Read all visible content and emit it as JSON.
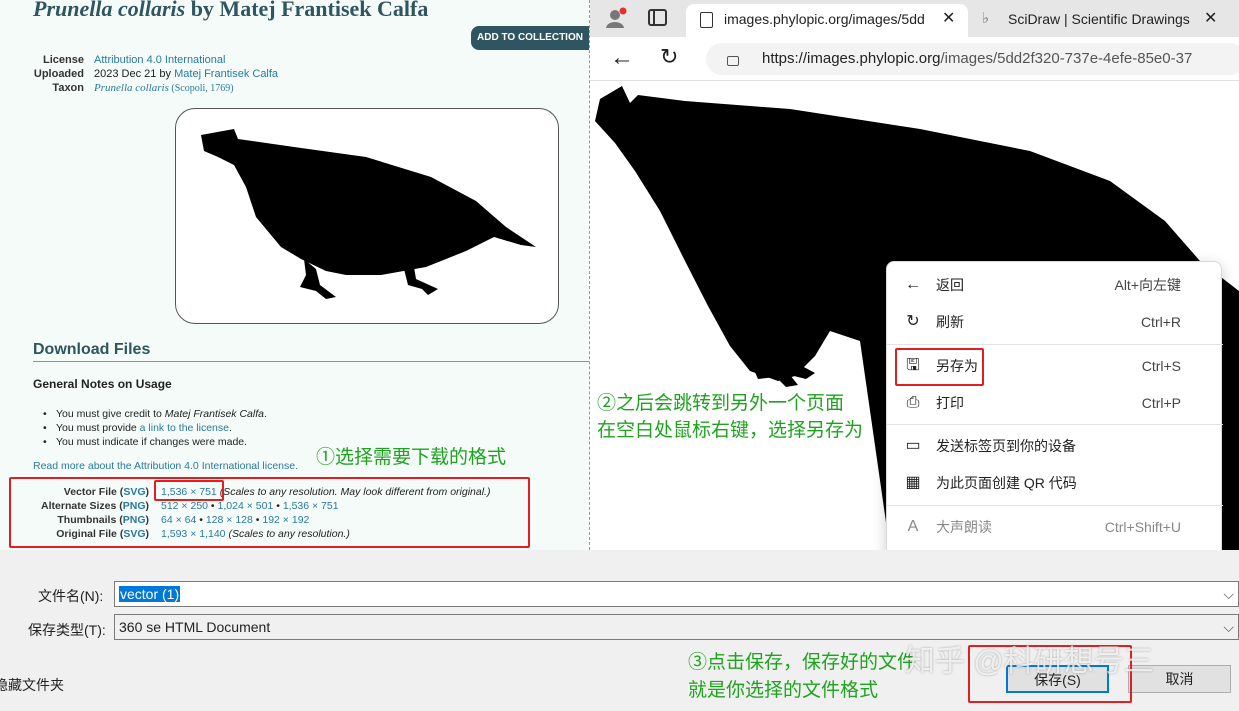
{
  "left_page": {
    "title_taxon": "Prunella collaris",
    "title_rest": " by Matej Frantisek Calfa",
    "add_button": "ADD TO COLLECTION",
    "meta": [
      {
        "key": "License",
        "value": "Attribution 4.0 International"
      },
      {
        "key": "Uploaded",
        "value": "2023 Dec 21 by ",
        "link": "Matej Frantisek Calfa"
      },
      {
        "key": "Taxon",
        "value": "Prunella collaris",
        "extra": " (Scopoli, 1769)"
      }
    ],
    "download_heading": "Download Files",
    "notes_heading": "General Notes on Usage",
    "notes": [
      {
        "pre": "You must give credit to ",
        "em": "Matej Frantisek Calfa",
        "post": ".",
        "link": ""
      },
      {
        "pre": "You must provide ",
        "em": "",
        "post": ".",
        "link": "a link to the license"
      },
      {
        "pre": "You must indicate if changes were made.",
        "em": "",
        "post": "",
        "link": ""
      }
    ],
    "read_more": "Read more about the Attribution 4.0 International license.",
    "files": [
      {
        "key": "Vector File (",
        "fmt": "SVG",
        "close": ")",
        "links": [
          "1,536 × 751"
        ],
        "note": "(Scales to any resolution. May look different from original.)"
      },
      {
        "key": "Alternate Sizes (",
        "fmt": "PNG",
        "close": ")",
        "links": [
          "512 × 250",
          "1,024 × 501",
          "1,536 × 751"
        ],
        "note": ""
      },
      {
        "key": "Thumbnails (",
        "fmt": "PNG",
        "close": ")",
        "links": [
          "64 × 64",
          "128 × 128",
          "192 × 192"
        ],
        "note": ""
      },
      {
        "key": "Original File (",
        "fmt": "SVG",
        "close": ")",
        "links": [
          "1,593 × 1,140"
        ],
        "note": "(Scales to any resolution.)"
      }
    ]
  },
  "annotations": {
    "step1": "①选择需要下载的格式",
    "step2_line1": "②之后会跳转到另外一个页面",
    "step2_line2": "在空白处鼠标右键，选择另存为",
    "step3_line1": "③点击保存，保存好的文件",
    "step3_line2": "就是你选择的文件格式"
  },
  "browser": {
    "tab1": "images.phylopic.org/images/5dd",
    "tab2": "SciDraw | Scientific Drawings",
    "url_host": "https://images.phylopic.org",
    "url_path": "/images/5dd2f320-737e-4efe-85e0-37"
  },
  "context_menu": [
    {
      "icon": "back-arrow-icon",
      "label": "返回",
      "shortcut": "Alt+向左键"
    },
    {
      "icon": "refresh-icon",
      "label": "刷新",
      "shortcut": "Ctrl+R"
    },
    {
      "icon": "save-as-icon",
      "label": "另存为",
      "shortcut": "Ctrl+S"
    },
    {
      "icon": "print-icon",
      "label": "打印",
      "shortcut": "Ctrl+P"
    },
    {
      "icon": "send-device-icon",
      "label": "发送标签页到你的设备",
      "shortcut": ""
    },
    {
      "icon": "qr-code-icon",
      "label": "为此页面创建 QR 代码",
      "shortcut": ""
    },
    {
      "icon": "read-aloud-icon",
      "label": "大声朗读",
      "shortcut": "Ctrl+Shift+U"
    }
  ],
  "dialog": {
    "filename_label": "文件名(N):",
    "filename_value": "vector (1)",
    "filetype_label": "保存类型(T):",
    "filetype_value": "360 se HTML Document",
    "hide_folders": "隐藏文件夹",
    "save_button": "保存(S)",
    "cancel_button": "取消"
  },
  "watermark": "知乎 @科研想号三",
  "colors": {
    "accent": "#2f5560",
    "link": "#2a7a9c",
    "highlight_red": "#e02020",
    "annotation_green": "#1fa31f"
  }
}
